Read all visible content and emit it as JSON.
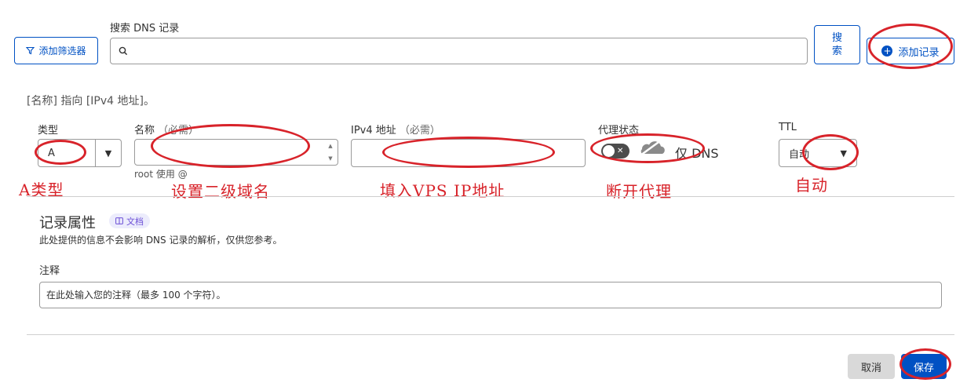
{
  "toolbar": {
    "filter_label": "添加筛选器",
    "search_label": "搜索 DNS 记录",
    "search_button_line1": "搜",
    "search_button_line2": "索",
    "add_record_label": "添加记录"
  },
  "record_preview": "[名称] 指向 [IPv4 地址]。",
  "form": {
    "type_label": "类型",
    "type_value": "A",
    "name_label": "名称",
    "name_required": "（必需）",
    "name_hint": "root 使用 @",
    "ipv4_label": "IPv4 地址",
    "ipv4_required": "（必需）",
    "proxy_label": "代理状态",
    "proxy_state": "仅 DNS",
    "ttl_label": "TTL",
    "ttl_value": "自动"
  },
  "annotations": {
    "type": "A类型",
    "name": "设置二级域名",
    "ipv4": "填入VPS IP地址",
    "proxy": "断开代理",
    "ttl": "自动"
  },
  "attributes": {
    "title": "记录属性",
    "doc_badge": "文档",
    "description": "此处提供的信息不会影响 DNS 记录的解析，仅供您参考。",
    "comment_label": "注释",
    "comment_placeholder": "在此处输入您的注释（最多 100 个字符）。"
  },
  "actions": {
    "cancel": "取消",
    "save": "保存"
  },
  "colors": {
    "accent": "#0051c3",
    "annotation": "#d8232a",
    "badge": "#6c4fd6"
  }
}
